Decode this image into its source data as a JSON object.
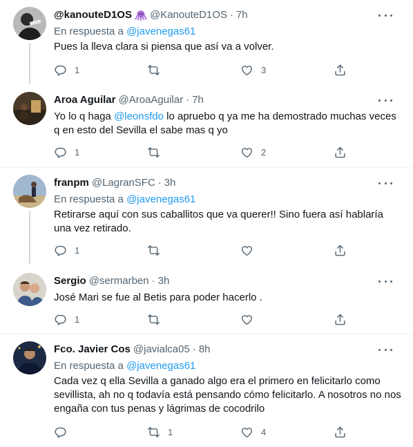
{
  "tweets": [
    {
      "name": "@kanouteD1OS",
      "emoji": "octopus-emoji",
      "handle": "@KanouteD1OS",
      "sep": "·",
      "time": "7h",
      "reply_prefix": "En respuesta a",
      "reply_to": "@javenegas61",
      "text": "Pues la lleva clara si piensa que así va a volver.",
      "replies": "1",
      "retweets": "",
      "likes": "3"
    },
    {
      "name": "Aroa Aguilar",
      "handle": "@AroaAguilar",
      "sep": "·",
      "time": "7h",
      "text_a": "Yo lo q haga",
      "text_mention": "@leonsfdo",
      "text_b": "lo apruebo q ya me ha demostrado muchas veces q en esto del Sevilla el sabe mas q yo",
      "replies": "1",
      "retweets": "",
      "likes": "2"
    },
    {
      "name": "franpm",
      "handle": "@LagranSFC",
      "sep": "·",
      "time": "3h",
      "reply_prefix": "En respuesta a",
      "reply_to": "@javenegas61",
      "text": "Retirarse aquí con sus caballitos que va querer!! Sino fuera así hablaría una vez retirado.",
      "replies": "1",
      "retweets": "",
      "likes": ""
    },
    {
      "name": "Sergio",
      "handle": "@sermarben",
      "sep": "·",
      "time": "3h",
      "text": "José Mari se fue al Betis para poder hacerlo .",
      "replies": "1",
      "retweets": "",
      "likes": ""
    },
    {
      "name": "Fco. Javier Cos",
      "handle": "@javialca05",
      "sep": "·",
      "time": "8h",
      "reply_prefix": "En respuesta a",
      "reply_to": "@javenegas61",
      "text": "Cada vez q ella Sevilla a ganado algo era el primero en felicitarlo como sevillista, ah no q todavía está pensando cómo felicitarlo. A nosotros no nos engaña con tus penas y lágrimas de cocodrilo",
      "replies": "",
      "retweets": "1",
      "likes": "4"
    }
  ],
  "colors": {
    "link": "#1d9bf0",
    "secondary": "#536471",
    "primary": "#0f1419",
    "thread": "#cfd9de",
    "separator": "#eff3f4"
  }
}
